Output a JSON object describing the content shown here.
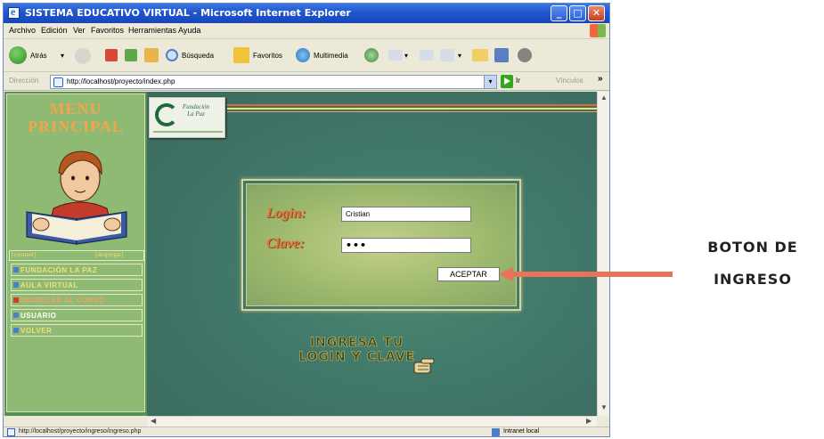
{
  "window": {
    "title": "SISTEMA EDUCATIVO VIRTUAL - Microsoft Internet Explorer"
  },
  "menubar": {
    "items": [
      "Archivo",
      "Edición",
      "Ver",
      "Favoritos",
      "Herramientas",
      "Ayuda"
    ]
  },
  "toolbar": {
    "back": "Atrás",
    "search": "Búsqueda",
    "favorites": "Favoritos",
    "multimedia": "Multimedia"
  },
  "address": {
    "label": "Dirección",
    "url": "http://localhost/proyecto/index.php",
    "go": "Ir",
    "links": "Vínculos"
  },
  "sidebar": {
    "title_line1": "MENU",
    "title_line2": "PRINCIPAL",
    "collapse": "[contraer]",
    "expand": "[desplegar]",
    "items": [
      {
        "label": "FUNDACIÓN LA PAZ",
        "color": "#f0e07a",
        "bullet": "#4a7ed0"
      },
      {
        "label": "AULA VIRTUAL",
        "color": "#f0e07a",
        "bullet": "#4a7ed0"
      },
      {
        "label": "INGRESAR AL CURSO",
        "color": "#f0a36a",
        "bullet": "#d23a2a"
      },
      {
        "label": "USUARIO",
        "color": "#ffffff",
        "bullet": "#4a7ed0"
      },
      {
        "label": "VOLVER",
        "color": "#f0e07a",
        "bullet": "#4a7ed0"
      }
    ]
  },
  "logo": {
    "text_line1": "Fundación",
    "text_line2": "La Paz"
  },
  "login": {
    "user_label": "Login:",
    "user_value": "Cristian",
    "pass_label": "Clave:",
    "pass_value": "•••",
    "submit": "ACEPTAR"
  },
  "prompt": {
    "line1": "INGRESA TU",
    "line2": "LOGIN Y CLAVE"
  },
  "status": {
    "url": "http://localhost/proyecto/ingreso/ingreso.php",
    "zone": "Intranet local"
  },
  "annotation": {
    "line1": "BOTON DE",
    "line2": "INGRESO",
    "arrow_color": "#e8735a"
  }
}
